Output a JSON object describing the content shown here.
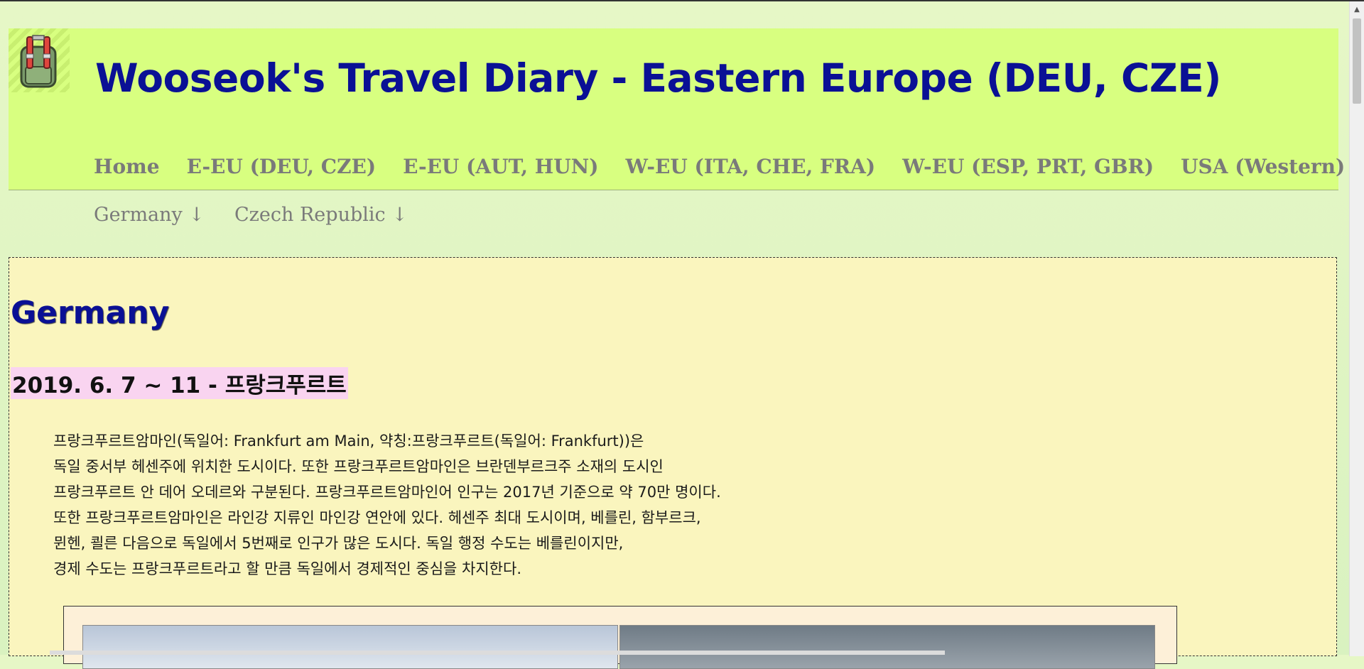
{
  "header": {
    "title": "Wooseok's Travel Diary - Eastern Europe (DEU, CZE)",
    "logo_icon": "backpack-icon"
  },
  "nav": {
    "items": [
      {
        "label": "Home"
      },
      {
        "label": "E-EU (DEU, CZE)"
      },
      {
        "label": "E-EU (AUT, HUN)"
      },
      {
        "label": "W-EU (ITA, CHE, FRA)"
      },
      {
        "label": "W-EU (ESP, PRT, GBR)"
      },
      {
        "label": "USA (Western)"
      }
    ]
  },
  "subnav": {
    "items": [
      {
        "label": "Germany ↓"
      },
      {
        "label": "Czech Republic ↓"
      }
    ]
  },
  "content": {
    "country": "Germany",
    "trip_heading": "2019. 6. 7 ~ 11 - 프랑크푸르트",
    "description": [
      "프랑크푸르트암마인(독일어: Frankfurt am Main, 약칭:프랑크푸르트(독일어: Frankfurt))은",
      "독일 중서부 헤센주에 위치한 도시이다. 또한 프랑크푸르트암마인은 브란덴부르크주 소재의 도시인",
      "프랑크푸르트 안 데어 오데르와 구분된다. 프랑크푸르트암마인어 인구는 2017년 기준으로 약 70만 명이다.",
      "또한 프랑크푸르트암마인은 라인강 지류인 마인강 연안에 있다. 헤센주 최대 도시이며, 베를린, 함부르크,",
      "뮌헨, 쾰른 다음으로 독일에서 5번째로 인구가 많은 도시다. 독일 행정 수도는 베를린이지만,",
      "경제 수도는 프랑크푸르트라고 할 만큼 독일에서 경제적인 중심을 차지한다."
    ]
  },
  "colors": {
    "header_bg": "#d8ff80",
    "title": "#0a1095",
    "content_bg": "#faf5be",
    "highlight": "#f9d4f0"
  }
}
